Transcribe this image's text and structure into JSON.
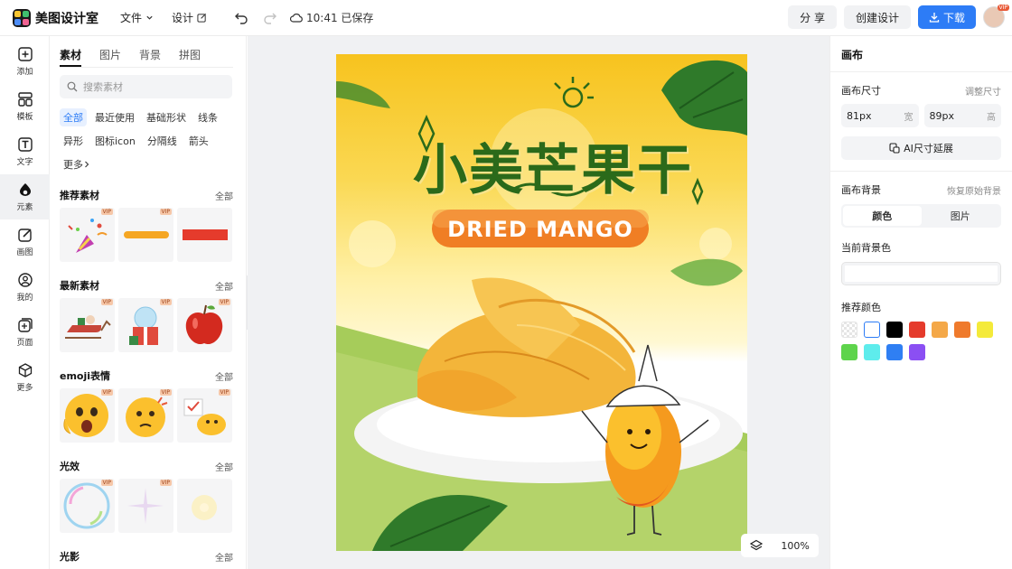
{
  "app": {
    "title": "美图设计室"
  },
  "topbar": {
    "file_menu": "文件",
    "design_menu": "设计",
    "save_status": "10:41 已保存",
    "share_label": "分 享",
    "create_label": "创建设计",
    "download_label": "下载",
    "avatar_badge": "VIP"
  },
  "leftbar": {
    "items": [
      {
        "label": "添加",
        "icon": "plus-square-icon"
      },
      {
        "label": "模板",
        "icon": "template-icon"
      },
      {
        "label": "文字",
        "icon": "text-icon"
      },
      {
        "label": "元素",
        "icon": "shapes-icon"
      },
      {
        "label": "画图",
        "icon": "draw-icon"
      },
      {
        "label": "我的",
        "icon": "user-icon"
      },
      {
        "label": "页面",
        "icon": "page-add-icon"
      },
      {
        "label": "更多",
        "icon": "cube-icon"
      }
    ]
  },
  "panel": {
    "tabs": [
      "素材",
      "图片",
      "背景",
      "拼图"
    ],
    "search_placeholder": "搜索素材",
    "chips": [
      "全部",
      "最近使用",
      "基础形状",
      "线条",
      "异形",
      "图标icon",
      "分隔线",
      "箭头",
      "更多"
    ],
    "sections": [
      {
        "title": "推荐素材",
        "all": "全部"
      },
      {
        "title": "最新素材",
        "all": "全部"
      },
      {
        "title": "emoji表情",
        "all": "全部"
      },
      {
        "title": "光效",
        "all": "全部"
      },
      {
        "title": "光影",
        "all": "全部"
      }
    ],
    "vip_badge": "VIP"
  },
  "canvas": {
    "poster_title": "小美芒果干",
    "poster_banner": "DRIED MANGO",
    "zoom": "100%"
  },
  "right": {
    "title": "画布",
    "size_label": "画布尺寸",
    "size_hint": "调整尺寸",
    "width_value": "81px",
    "width_unit": "宽",
    "height_value": "89px",
    "height_unit": "高",
    "ai_button": "AI尺寸延展",
    "bg_label": "画布背景",
    "bg_hint": "恢复原始背景",
    "seg_color": "颜色",
    "seg_image": "图片",
    "current_bg": "当前背景色",
    "recommend": "推荐颜色",
    "swatches": [
      "transparent",
      "#ffffff",
      "#000000",
      "#e53b2c",
      "#f4a848",
      "#ef7a2c",
      "#f4ea3a",
      "#5ed44c",
      "#5eecec",
      "#2f7ff3",
      "#8b4ff3"
    ]
  }
}
